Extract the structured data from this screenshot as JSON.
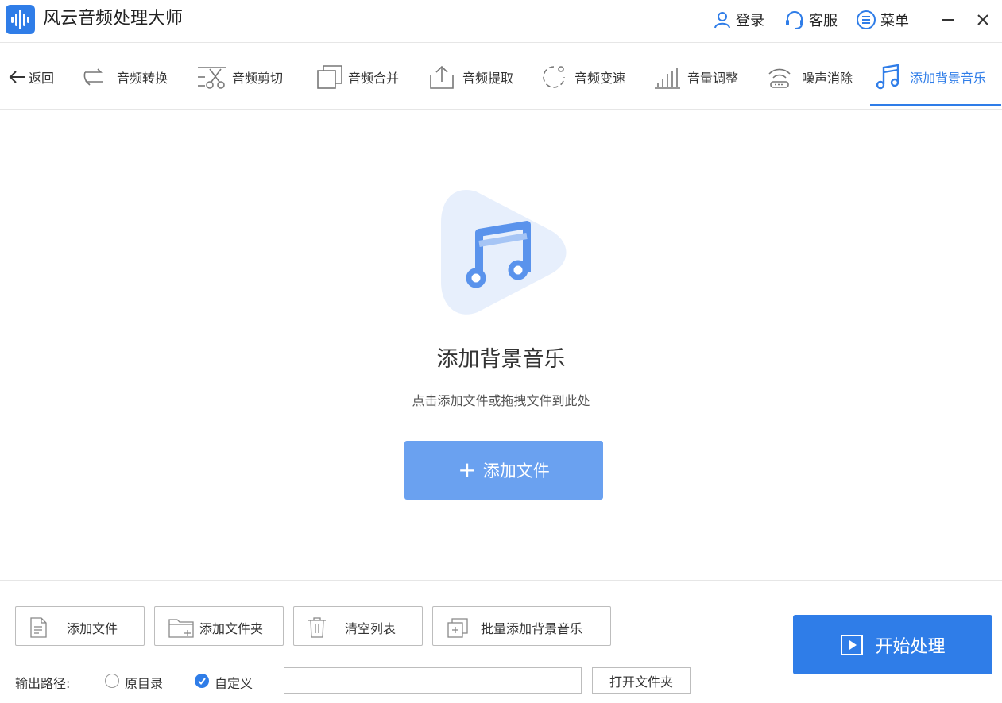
{
  "app": {
    "title": "风云音频处理大师",
    "accent": "#2f7de8",
    "accent_light": "#6aa1f0"
  },
  "titlebar": {
    "login": "登录",
    "service": "客服",
    "menu": "菜单"
  },
  "nav": {
    "back": "返回",
    "items": [
      {
        "label": "音频转换",
        "icon": "convert-icon"
      },
      {
        "label": "音频剪切",
        "icon": "scissors-icon"
      },
      {
        "label": "音频合并",
        "icon": "merge-icon"
      },
      {
        "label": "音频提取",
        "icon": "upload-icon"
      },
      {
        "label": "音频变速",
        "icon": "speed-icon"
      },
      {
        "label": "音量调整",
        "icon": "volume-bars-icon"
      },
      {
        "label": "噪声消除",
        "icon": "noise-icon"
      },
      {
        "label": "添加背景音乐",
        "icon": "music-note-icon",
        "active": true
      }
    ]
  },
  "drop": {
    "title": "添加背景音乐",
    "hint": "点击添加文件或拖拽文件到此处",
    "add_button": "添加文件"
  },
  "toolbar": {
    "add_file": "添加文件",
    "add_folder": "添加文件夹",
    "clear_list": "清空列表",
    "batch_add": "批量添加背景音乐",
    "start": "开始处理"
  },
  "output": {
    "label": "输出路径:",
    "option_original": "原目录",
    "option_custom": "自定义",
    "selected": "自定义",
    "path_value": "",
    "open_folder": "打开文件夹"
  }
}
